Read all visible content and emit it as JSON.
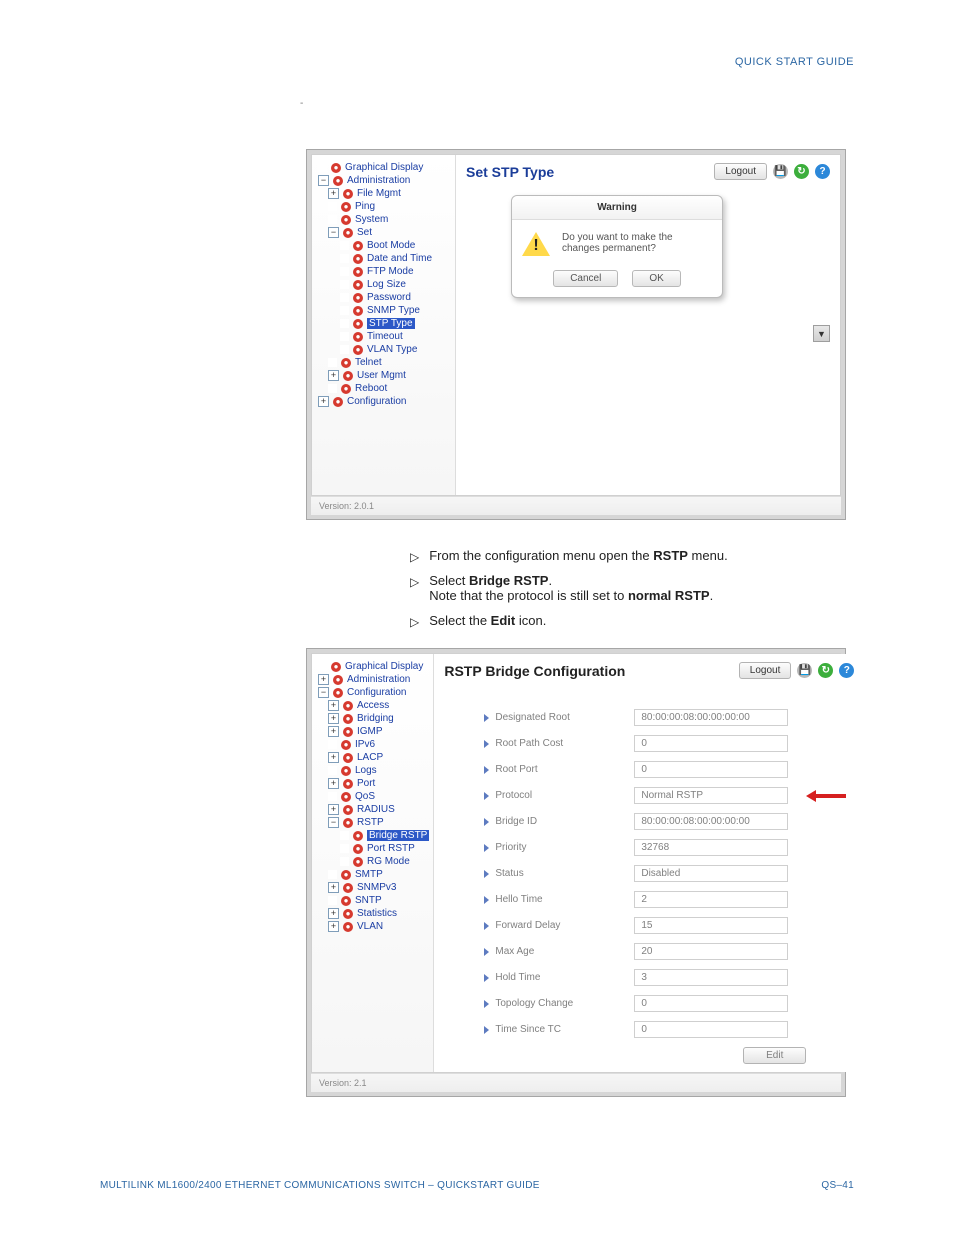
{
  "header": {
    "quick_start": "QUICK START GUIDE"
  },
  "tiny_dash": "-",
  "shot1": {
    "title": "Set STP Type",
    "logout": "Logout",
    "nav": {
      "graphical": "Graphical Display",
      "administration": "Administration",
      "file_mgmt": "File Mgmt",
      "ping": "Ping",
      "system": "System",
      "set": "Set",
      "boot_mode": "Boot Mode",
      "date_time": "Date and Time",
      "ftp_mode": "FTP Mode",
      "log_size": "Log Size",
      "password": "Password",
      "snmp_type": "SNMP Type",
      "stp_type": "STP Type",
      "timeout": "Timeout",
      "vlan_type": "VLAN Type",
      "telnet": "Telnet",
      "user_mgmt": "User Mgmt",
      "reboot": "Reboot",
      "configuration": "Configuration"
    },
    "dialog": {
      "title": "Warning",
      "text_l1": "Do you want to make the",
      "text_l2": "changes permanent?",
      "cancel": "Cancel",
      "ok": "OK"
    },
    "version": "Version: 2.0.1"
  },
  "instructions": {
    "i1": "From the configuration menu open the ",
    "i1_bold": "RSTP",
    "i1_after": " menu.",
    "i2": "Select ",
    "i2_bold": "Bridge RSTP",
    "i2_after": ".",
    "i2_note_a": "Note that the protocol is still set to ",
    "i2_note_bold": "normal RSTP",
    "i2_note_after": ".",
    "i3": "Select the ",
    "i3_bold": "Edit",
    "i3_after": " icon."
  },
  "shot2": {
    "title": "RSTP Bridge Configuration",
    "logout": "Logout",
    "nav": {
      "graphical": "Graphical Display",
      "administration": "Administration",
      "configuration": "Configuration",
      "access": "Access",
      "bridging": "Bridging",
      "igmp": "IGMP",
      "ipv6": "IPv6",
      "lacp": "LACP",
      "logs": "Logs",
      "port": "Port",
      "qos": "QoS",
      "radius": "RADIUS",
      "rstp": "RSTP",
      "bridge_rstp": "Bridge RSTP",
      "port_rstp": "Port RSTP",
      "rg_mode": "RG Mode",
      "smtp": "SMTP",
      "snmpv3": "SNMPv3",
      "sntp": "SNTP",
      "statistics": "Statistics",
      "vlan": "VLAN"
    },
    "fields": {
      "designated_root": {
        "label": "Designated Root",
        "value": "80:00:00:08:00:00:00:00"
      },
      "root_path_cost": {
        "label": "Root Path Cost",
        "value": "0"
      },
      "root_port": {
        "label": "Root Port",
        "value": "0"
      },
      "protocol": {
        "label": "Protocol",
        "value": "Normal RSTP"
      },
      "bridge_id": {
        "label": "Bridge ID",
        "value": "80:00:00:08:00:00:00:00"
      },
      "priority": {
        "label": "Priority",
        "value": "32768"
      },
      "status": {
        "label": "Status",
        "value": "Disabled"
      },
      "hello_time": {
        "label": "Hello Time",
        "value": "2"
      },
      "forward_delay": {
        "label": "Forward Delay",
        "value": "15"
      },
      "max_age": {
        "label": "Max Age",
        "value": "20"
      },
      "hold_time": {
        "label": "Hold Time",
        "value": "3"
      },
      "topology_change": {
        "label": "Topology Change",
        "value": "0"
      },
      "time_since_tc": {
        "label": "Time Since TC",
        "value": "0"
      }
    },
    "edit": "Edit",
    "version": "Version: 2.1"
  },
  "footer": {
    "left": "MULTILINK ML1600/2400 ETHERNET COMMUNICATIONS SWITCH – QUICKSTART GUIDE",
    "right": "QS–41"
  }
}
